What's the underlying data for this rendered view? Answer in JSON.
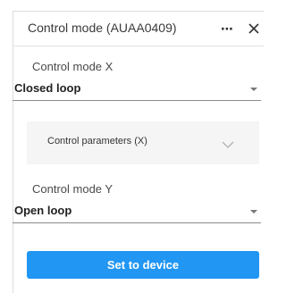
{
  "header": {
    "title": "Control mode (AUAA0409)",
    "more_icon": "more-horizontal-icon",
    "more_glyph": "⋯",
    "close_icon": "close-icon"
  },
  "control_mode_x": {
    "label": "Control mode X",
    "value": "Closed loop"
  },
  "control_parameters": {
    "label": "Control parameters (X)",
    "expanded": false,
    "icon": "chevron-down-icon"
  },
  "control_mode_y": {
    "label": "Control mode Y",
    "value": "Open loop"
  },
  "actions": {
    "set_to_device_label": "Set to device"
  },
  "colors": {
    "accent": "#2196f3",
    "expander_background": "#f5f5f5"
  }
}
